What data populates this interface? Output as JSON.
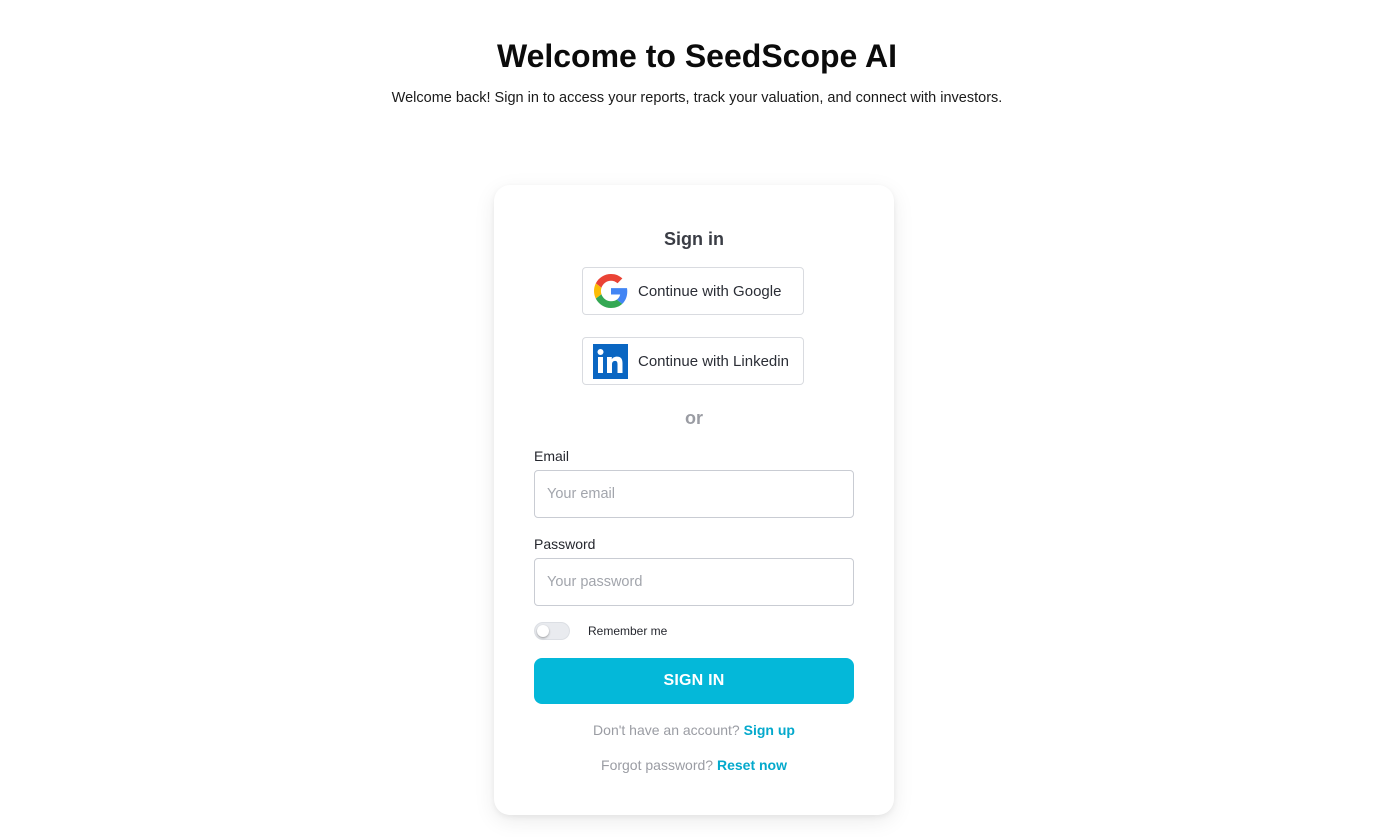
{
  "hero": {
    "title": "Welcome to SeedScope AI",
    "subtitle": "Welcome back! Sign in to access your reports, track your valuation, and connect with investors."
  },
  "card": {
    "title": "Sign in",
    "google_label": "Continue with Google",
    "linkedin_label": "Continue with Linkedin",
    "or_text": "or",
    "email_label": "Email",
    "email_placeholder": "Your email",
    "email_value": "",
    "password_label": "Password",
    "password_placeholder": "Your password",
    "password_value": "",
    "remember_label": "Remember me",
    "remember_checked": false,
    "signin_label": "SIGN IN",
    "signup_prompt": "Don't have an account?",
    "signup_link": "Sign up",
    "forgot_prompt": "Forgot password?",
    "reset_link": "Reset now"
  },
  "icons": {
    "google": "google-icon",
    "linkedin": "linkedin-icon"
  },
  "colors": {
    "accent": "#04b8d9",
    "link": "#04a9cc",
    "linkedin_blue": "#0a66c2"
  }
}
